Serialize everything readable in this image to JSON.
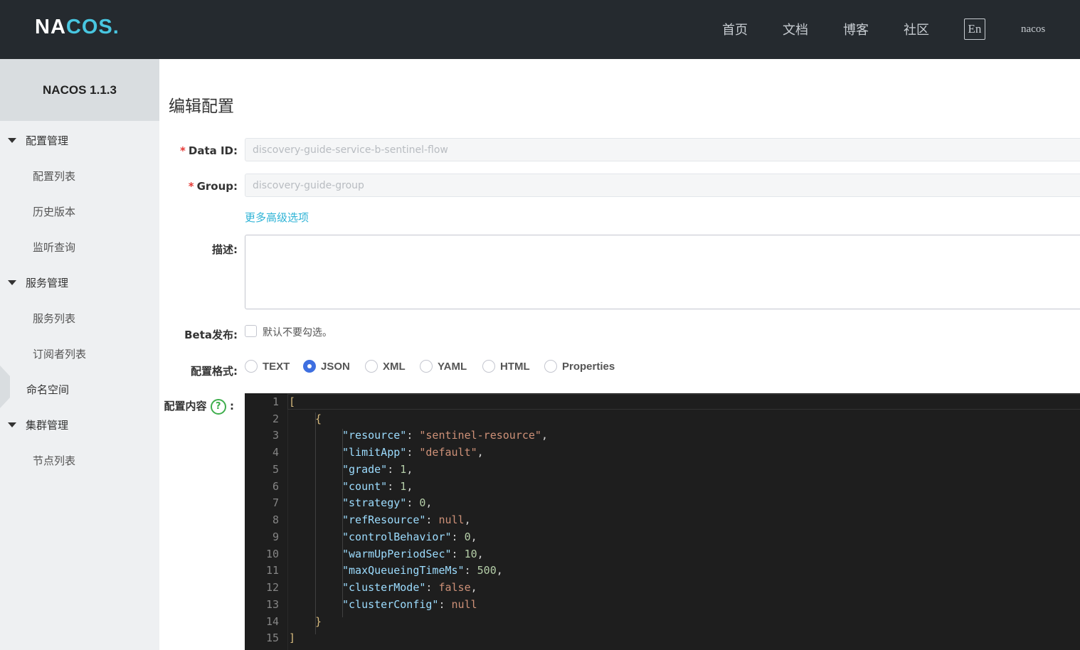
{
  "header": {
    "logo": {
      "part1": "NA",
      "part2": "COS",
      "dot": "."
    },
    "nav": [
      "首页",
      "文档",
      "博客",
      "社区"
    ],
    "lang_button": "En",
    "username": "nacos"
  },
  "sidebar": {
    "version": "NACOS 1.1.3",
    "groups": [
      {
        "label": "配置管理",
        "items": [
          "配置列表",
          "历史版本",
          "监听查询"
        ]
      },
      {
        "label": "服务管理",
        "items": [
          "服务列表",
          "订阅者列表"
        ]
      },
      {
        "label": "命名空间"
      },
      {
        "label": "集群管理",
        "items": [
          "节点列表"
        ]
      }
    ]
  },
  "form": {
    "title": "编辑配置",
    "data_id": {
      "label": "Data ID:",
      "value": "discovery-guide-service-b-sentinel-flow"
    },
    "group": {
      "label": "Group:",
      "value": "discovery-guide-group"
    },
    "required_mark": "*",
    "more_options": "更多高级选项",
    "description": {
      "label": "描述:",
      "value": ""
    },
    "beta": {
      "label": "Beta发布:",
      "checkbox_label": "默认不要勾选。",
      "checked": false
    },
    "format": {
      "label": "配置格式:",
      "options": [
        "TEXT",
        "JSON",
        "XML",
        "YAML",
        "HTML",
        "Properties"
      ],
      "selected": "JSON"
    },
    "content": {
      "label": "配置内容",
      "help": "?",
      "colon": ":",
      "line_numbers": [
        "1",
        "2",
        "3",
        "4",
        "5",
        "6",
        "7",
        "8",
        "9",
        "10",
        "11",
        "12",
        "13",
        "14",
        "15"
      ],
      "tokens": {
        "l1": "[",
        "l2": "{",
        "l3k": "\"resource\"",
        "l3v": "\"sentinel-resource\"",
        "l4k": "\"limitApp\"",
        "l4v": "\"default\"",
        "l5k": "\"grade\"",
        "l5v": "1",
        "l6k": "\"count\"",
        "l6v": "1",
        "l7k": "\"strategy\"",
        "l7v": "0",
        "l8k": "\"refResource\"",
        "l8v": "null",
        "l9k": "\"controlBehavior\"",
        "l9v": "0",
        "l10k": "\"warmUpPeriodSec\"",
        "l10v": "10",
        "l11k": "\"maxQueueingTimeMs\"",
        "l11v": "500",
        "l12k": "\"clusterMode\"",
        "l12v": "false",
        "l13k": "\"clusterConfig\"",
        "l13v": "null",
        "l14": "}",
        "l15": "]"
      }
    }
  },
  "colors": {
    "topbar": "#252a2f",
    "brand_accent": "#48c6e0",
    "link": "#2eb3d6",
    "radio_selected": "#3e6fe0",
    "editor_bg": "#1e1e1e"
  }
}
